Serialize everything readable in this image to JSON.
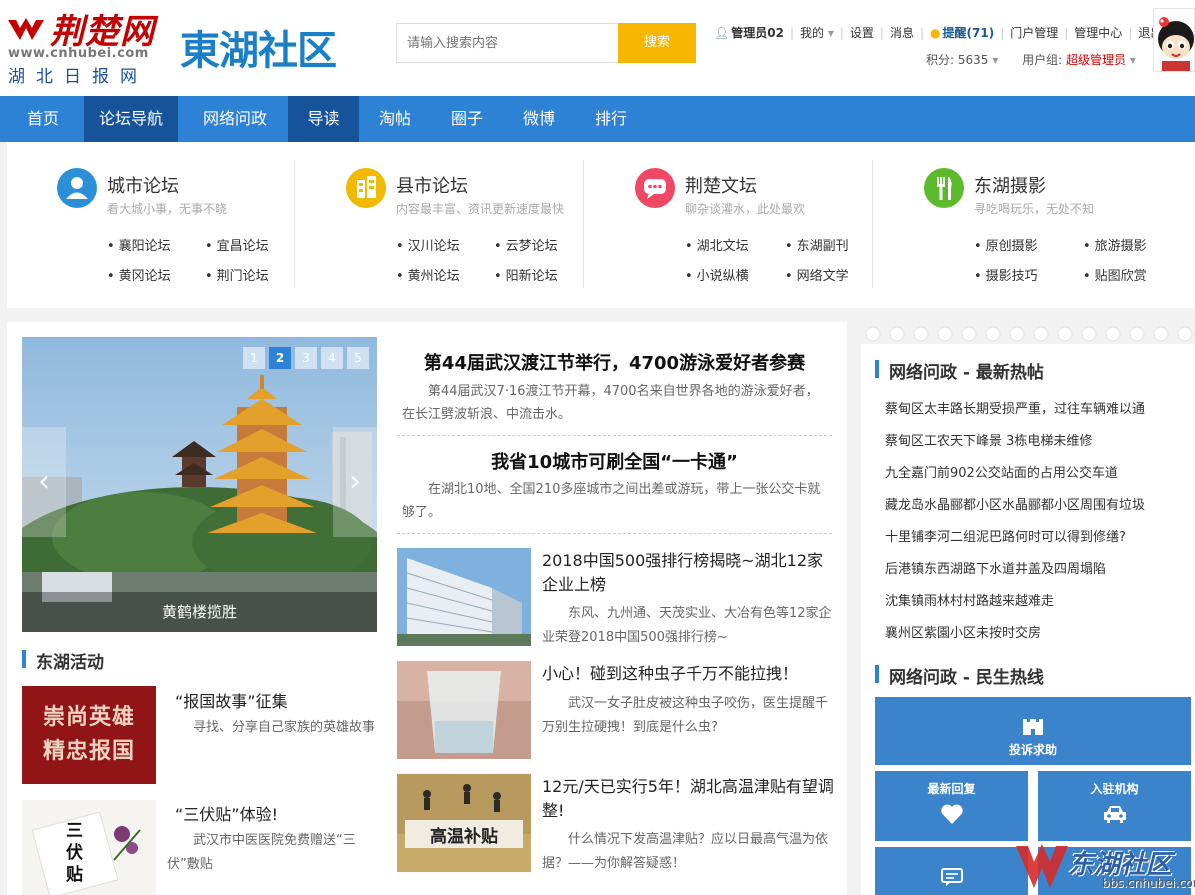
{
  "header": {
    "brand_text": "荆楚网",
    "brand_url": "www.cnhubei.com",
    "brand_name": "湖北日报网",
    "community_logo": "東湖社区",
    "search": {
      "placeholder": "请输入搜索内容",
      "button": "搜索"
    },
    "user": {
      "name": "管理员02",
      "my": "我的",
      "settings": "设置",
      "messages": "消息",
      "remind": "提醒(71)",
      "portal_admin": "门户管理",
      "admin_center": "管理中心",
      "logout": "退出",
      "points": "积分: 5635",
      "group_label": "用户组:",
      "group_value": "超级管理员"
    }
  },
  "nav": {
    "items": [
      {
        "label": "首页"
      },
      {
        "label": "论坛导航"
      },
      {
        "label": "网络问政"
      },
      {
        "label": "导读"
      },
      {
        "label": "淘帖"
      },
      {
        "label": "圈子"
      },
      {
        "label": "微博"
      },
      {
        "label": "排行"
      }
    ]
  },
  "forums": [
    {
      "title": "城市论坛",
      "subtitle": "看大城小事，无事不晓",
      "icon": "user-icon",
      "color": "#2b8fd8",
      "links": [
        "襄阳论坛",
        "宜昌论坛",
        "黄冈论坛",
        "荆门论坛"
      ]
    },
    {
      "title": "县市论坛",
      "subtitle": "内容最丰富、资讯更新速度最快",
      "icon": "building-icon",
      "color": "#f1b900",
      "links": [
        "汉川论坛",
        "云梦论坛",
        "黄州论坛",
        "阳新论坛"
      ]
    },
    {
      "title": "荆楚文坛",
      "subtitle": "聊杂谈灌水，此处最欢",
      "icon": "chat-icon",
      "color": "#f04864",
      "links": [
        "湖北文坛",
        "东湖副刊",
        "小说纵横",
        "网络文学"
      ]
    },
    {
      "title": "东湖摄影",
      "subtitle": "寻吃喝玩乐，无处不知",
      "icon": "cutlery-icon",
      "color": "#5cbb2c",
      "links": [
        "原创摄影",
        "旅游摄影",
        "摄影技巧",
        "贴图欣赏"
      ]
    }
  ],
  "slider": {
    "caption": "黄鹤楼揽胜",
    "pages": [
      "1",
      "2",
      "3",
      "4",
      "5"
    ],
    "active": "2"
  },
  "activities": {
    "heading": "东湖活动",
    "items": [
      {
        "title": "“报国故事”征集",
        "desc": "寻找、分享自己家族的英雄故事",
        "img_text": "崇尚英雄 精忠报国"
      },
      {
        "title": "“三伏贴”体验!",
        "desc": "武汉市中医医院免费赠送“三伏”敷贴",
        "img_text": "三伏贴"
      }
    ]
  },
  "headlines": [
    {
      "title": "第44届武汉渡江节举行，4700游泳爱好者参赛",
      "desc": "第44届武汉7·16渡江节开幕，4700名来自世界各地的游泳爱好者，在长江劈波斩浪、中流击水。"
    },
    {
      "title": "我省10城市可刷全国“一卡通”",
      "desc": "在湖北10地、全国210多座城市之间出差或游玩，带上一张公交卡就够了。"
    }
  ],
  "news": [
    {
      "title": "2018中国500强排行榜揭晓~湖北12家企业上榜",
      "desc": "东风、九州通、天茂实业、大冶有色等12家企业荣登2018中国500强排行榜~"
    },
    {
      "title": "小心！碰到这种虫子千万不能拉拽！",
      "desc": "武汉一女子肚皮被这种虫子咬伤，医生提醒千万别生拉硬拽！到底是什么虫?"
    },
    {
      "title": "12元/天已实行5年！湖北高温津贴有望调整!",
      "desc": "什么情况下发高温津贴？应以日最高气温为依据？——为你解答疑惑！",
      "img_text": "高温补贴"
    }
  ],
  "sidebar": {
    "hot_heading": "网络问政 - 最新热帖",
    "hot_items": [
      "蔡甸区太丰路长期受损严重，过往车辆难以通",
      "蔡甸区工农天下峰景 3栋电梯未维修",
      "九全嘉门前902公交站面的占用公交车道",
      "藏龙岛水晶郦都小区水晶郦都小区周围有垃圾",
      "十里铺李河二组泥巴路何时可以得到修缮?",
      "后港镇东西湖路下水道井盖及四周塌陷",
      "沈集镇雨林村村路越来越难走",
      "襄州区紫園小区未按时交房"
    ],
    "hotline_heading": "网络问政 - 民生热线",
    "tiles": [
      {
        "label": "投诉求助",
        "icon": "castle-icon"
      },
      {
        "label": "最新回复",
        "icon": "heart-icon"
      },
      {
        "label": "入驻机构",
        "icon": "car-icon"
      },
      {
        "label": "",
        "icon": "message-icon"
      }
    ],
    "watermark": "东湖社区",
    "watermark_url": "bbs.cnhubei.com"
  }
}
